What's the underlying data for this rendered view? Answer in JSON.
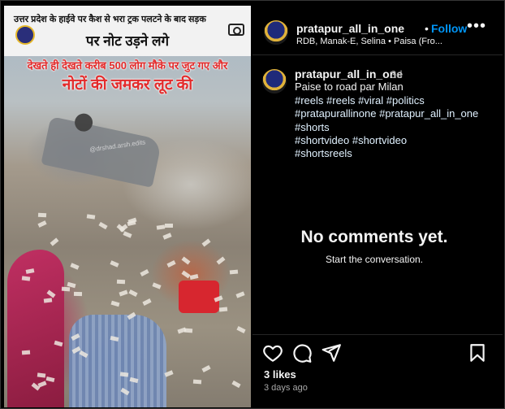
{
  "media": {
    "headline_line1": "उत्तर प्रदेश के हाईवे पर कैश से भरा ट्रक पलटने के बाद सड़क",
    "headline_line2": "पर नोट उड़ने लगे",
    "subtitle_line1": "देखते ही देखते करीब 500 लोग मौके पर जुट गए और",
    "subtitle_line2": "नोटों की जमकर लूट की",
    "watermark": "@drshad.arsh.edits"
  },
  "post_header": {
    "username": "pratapur_all_in_one",
    "separator": "•",
    "follow_label": "Follow",
    "audio": "RDB, Manak-E, Selina • Paisa (Fro...",
    "more_icon": "more-horizontal-icon"
  },
  "caption": {
    "username": "pratapur_all_in_one",
    "time": "3d",
    "text": "Paise to road par Milan",
    "hashtags": [
      "#reels",
      "#reels",
      "#viral",
      "#politics",
      "#pratapurallinone",
      "#pratapur_all_in_one",
      "#shorts",
      "#shortvideo",
      "#shortvideo",
      "#shortsreels"
    ]
  },
  "comments": {
    "empty_title": "No comments yet.",
    "empty_subtitle": "Start the conversation."
  },
  "actions": {
    "icons": [
      "heart-icon",
      "comment-icon",
      "share-icon",
      "bookmark-icon"
    ],
    "likes": "3 likes",
    "date": "3 days ago"
  },
  "colors": {
    "background": "#000000",
    "follow": "#0095f6",
    "hashtag": "#e0f1ff",
    "muted": "#a8a8a8",
    "media_headline_red": "#e32b2b"
  }
}
